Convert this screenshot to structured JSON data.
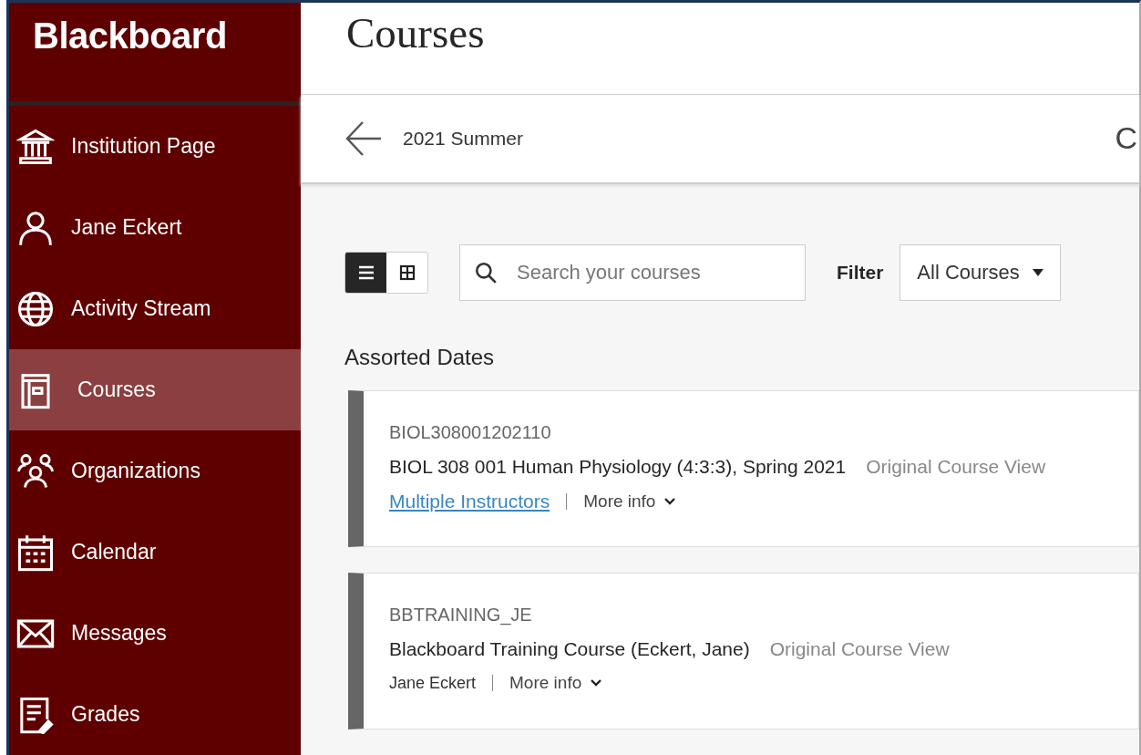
{
  "brand": {
    "logo": "Blackboard"
  },
  "nav": [
    {
      "label": "Institution Page",
      "kind": "institution",
      "selected": false
    },
    {
      "label": "Jane Eckert",
      "kind": "person",
      "selected": false
    },
    {
      "label": "Activity Stream",
      "kind": "globe",
      "selected": false
    },
    {
      "label": "Courses",
      "kind": "book",
      "selected": true
    },
    {
      "label": "Organizations",
      "kind": "people",
      "selected": false
    },
    {
      "label": "Calendar",
      "kind": "calendar",
      "selected": false
    },
    {
      "label": "Messages",
      "kind": "envelope",
      "selected": false
    },
    {
      "label": "Grades",
      "kind": "grades",
      "selected": false
    }
  ],
  "page_title": "Courses",
  "term_bar": {
    "term": "2021 Summer",
    "cut_label": "C"
  },
  "toolbar": {
    "views": [
      {
        "kind": "list",
        "selected": true
      },
      {
        "kind": "grid",
        "selected": false
      }
    ],
    "search": {
      "placeholder": "Search your courses"
    },
    "filter": {
      "label": "Filter",
      "value": "All Courses"
    }
  },
  "section_title": "Assorted Dates",
  "courses": [
    {
      "code": "BIOL308001202110",
      "name": "BIOL 308 001 Human Physiology (4:3:3), Spring 2021",
      "view": "Original Course View",
      "instructor": {
        "text": "Multiple Instructors",
        "kind": "link"
      },
      "more": "More info"
    },
    {
      "code": "BBTRAINING_JE",
      "name": "Blackboard Training Course (Eckert, Jane)",
      "view": "Original Course View",
      "instructor": {
        "text": "Jane Eckert",
        "kind": "plain"
      },
      "more": "More info"
    }
  ]
}
